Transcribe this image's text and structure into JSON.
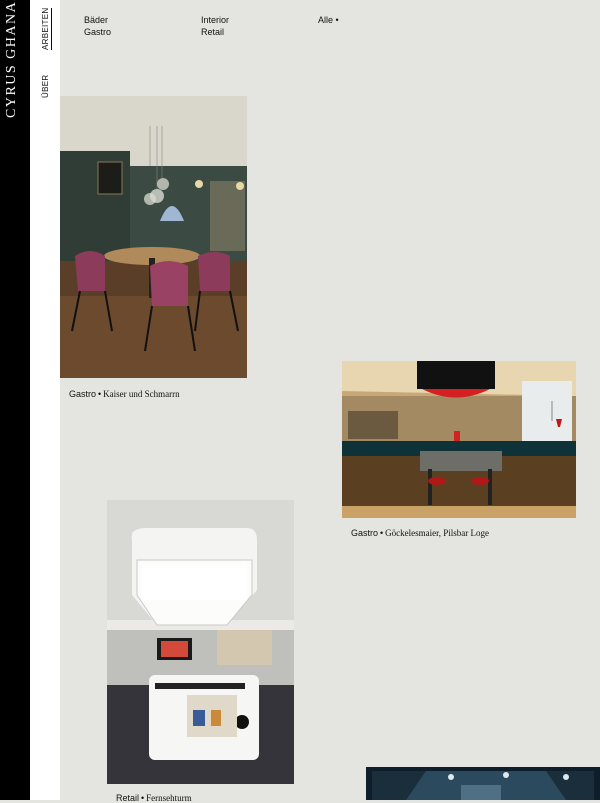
{
  "brand": {
    "name": "CYRUS GHANAI"
  },
  "nav": {
    "arbeiten": "ARBEITEN",
    "uber": "ÜBER"
  },
  "filters": {
    "col1": [
      "Bäder",
      "Gastro"
    ],
    "col2": [
      "Interior",
      "Retail"
    ],
    "col3": [
      "Alle •"
    ]
  },
  "projects": [
    {
      "category": "Gastro",
      "title": "Kaiser und Schmarrn"
    },
    {
      "category": "Gastro",
      "title": "Göckelesmaier, Pilsbar Loge"
    },
    {
      "category": "Retail",
      "title": "Fernsehturm"
    }
  ],
  "separator": "•"
}
